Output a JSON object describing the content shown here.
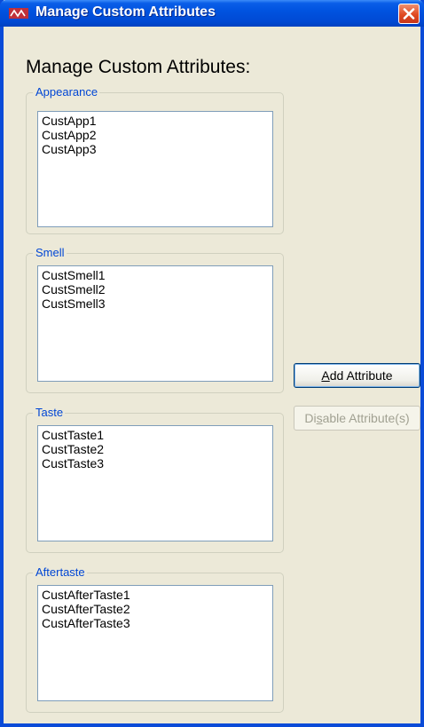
{
  "window": {
    "title": "Manage Custom Attributes",
    "colors": {
      "titlebar": "#0053e0",
      "frame": "#0a4bd8",
      "close": "#e04a22",
      "background": "#ece9d8",
      "group_label": "#0046d5"
    }
  },
  "heading": "Manage Custom Attributes:",
  "groups": [
    {
      "label": "Appearance",
      "items": [
        "CustApp1",
        "CustApp2",
        "CustApp3"
      ]
    },
    {
      "label": "Smell",
      "items": [
        "CustSmell1",
        "CustSmell2",
        "CustSmell3"
      ]
    },
    {
      "label": "Taste",
      "items": [
        "CustTaste1",
        "CustTaste2",
        "CustTaste3"
      ]
    },
    {
      "label": "Aftertaste",
      "items": [
        "CustAfterTaste1",
        "CustAfterTaste2",
        "CustAfterTaste3"
      ]
    }
  ],
  "buttons": {
    "add": {
      "mnemonic": "A",
      "rest": "dd Attribute",
      "enabled": true
    },
    "disable": {
      "prefix": "Di",
      "mnemonic": "s",
      "rest": "able Attribute(s)",
      "enabled": false
    }
  },
  "icons": {
    "app": "app-logo-icon",
    "close": "close-icon"
  }
}
